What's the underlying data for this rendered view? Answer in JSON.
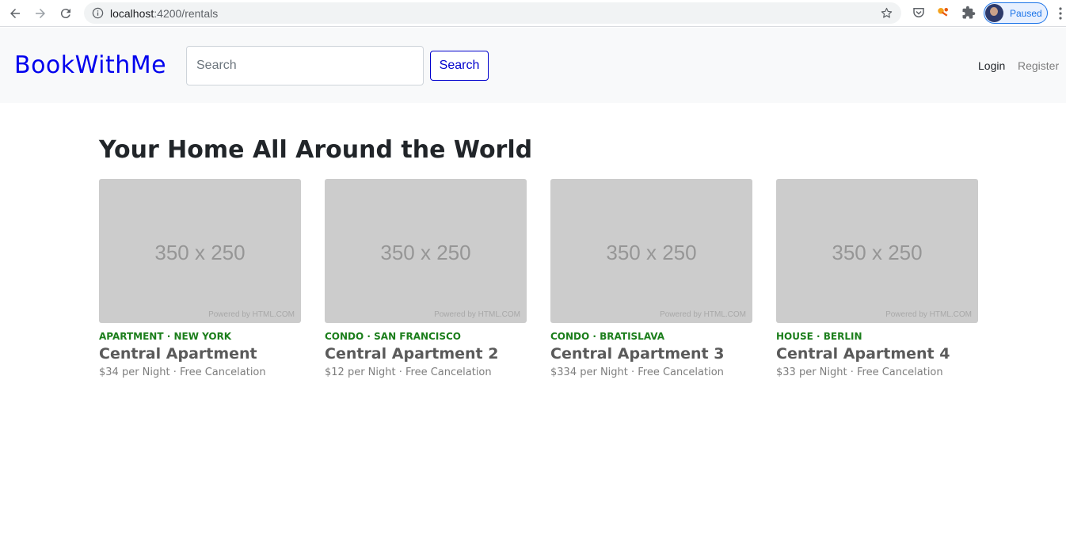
{
  "browser": {
    "url_host": "localhost",
    "url_path": ":4200/rentals",
    "profile_label": "Paused"
  },
  "navbar": {
    "brand": "BookWithMe",
    "search_placeholder": "Search",
    "search_button": "Search",
    "login": "Login",
    "register": "Register"
  },
  "main": {
    "title": "Your Home All Around the World"
  },
  "rentals": [
    {
      "category": "Apartment",
      "city": "New York",
      "title": "Central Apartment",
      "subtitle": "$34 per Night · Free Cancelation",
      "image_text": "350 x 250",
      "image_credit": "Powered by HTML.COM"
    },
    {
      "category": "Condo",
      "city": "San Francisco",
      "title": "Central Apartment 2",
      "subtitle": "$12 per Night · Free Cancelation",
      "image_text": "350 x 250",
      "image_credit": "Powered by HTML.COM"
    },
    {
      "category": "Condo",
      "city": "Bratislava",
      "title": "Central Apartment 3",
      "subtitle": "$334 per Night · Free Cancelation",
      "image_text": "350 x 250",
      "image_credit": "Powered by HTML.COM"
    },
    {
      "category": "House",
      "city": "Berlin",
      "title": "Central Apartment 4",
      "subtitle": "$33 per Night · Free Cancelation",
      "image_text": "350 x 250",
      "image_credit": "Powered by HTML.COM"
    }
  ],
  "colors": {
    "brand": "#0000ee",
    "category": "#1b7e1b",
    "placeholder_image": "#cccccc"
  },
  "icons": [
    "back-arrow-icon",
    "forward-arrow-icon",
    "reload-icon",
    "info-icon",
    "star-icon",
    "pocket-icon",
    "key-icon",
    "puzzle-icon",
    "kebab-menu-icon"
  ]
}
